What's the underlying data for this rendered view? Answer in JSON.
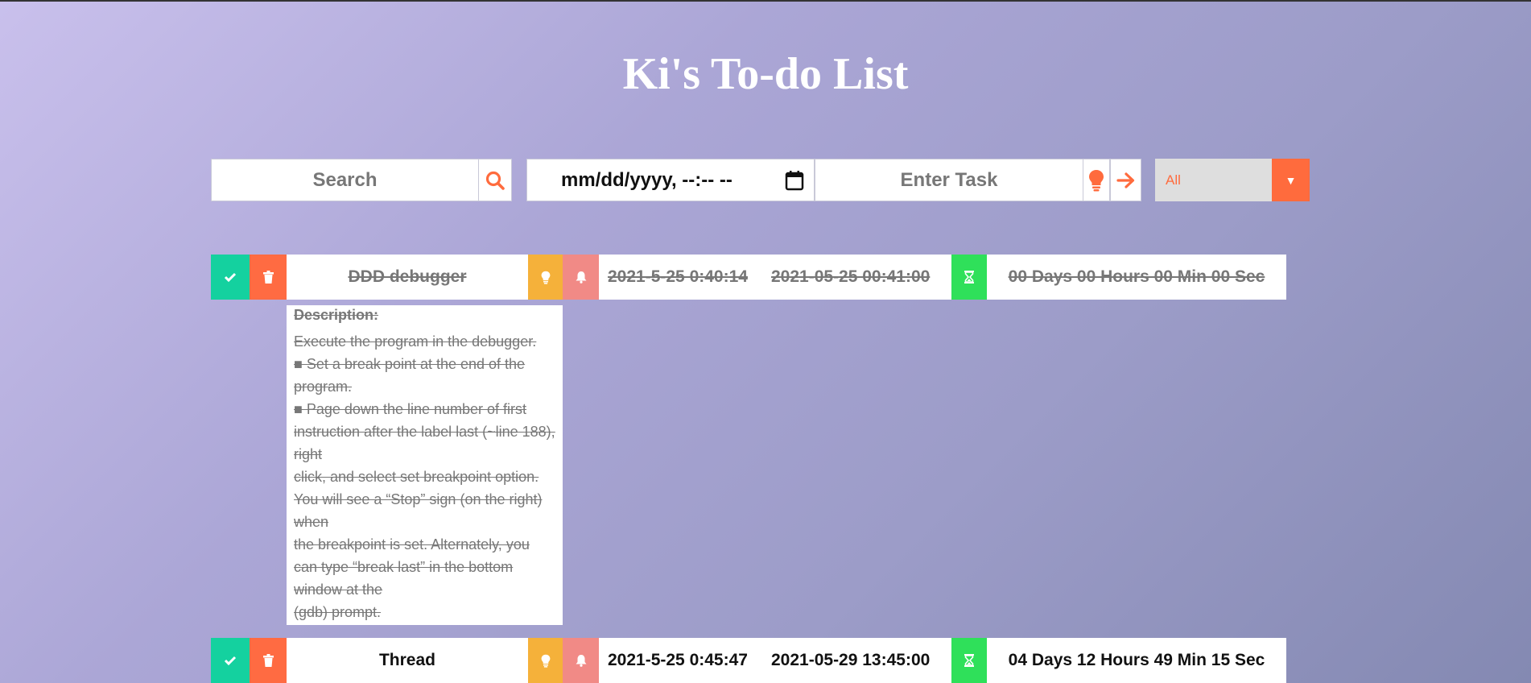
{
  "app": {
    "title": "Ki's To-do List"
  },
  "controls": {
    "search_placeholder": "Search",
    "datetime_placeholder": "mm/dd/yyyy, --:-- --",
    "task_placeholder": "Enter Task",
    "filter_selected": "All"
  },
  "colors": {
    "accent": "#ff6b3d",
    "complete": "#14d19f",
    "delete": "#ff6b42",
    "idea": "#f5b13a",
    "reminder": "#f18a86",
    "timer": "#2fe05a"
  },
  "icons": {
    "search": "search-icon",
    "calendar": "calendar-icon",
    "bulb": "lightbulb-icon",
    "arrow": "arrow-right-icon",
    "check": "check-icon",
    "trash": "trash-icon",
    "bell": "bell-icon",
    "hourglass": "hourglass-icon"
  },
  "tasks": [
    {
      "name": "DDD debugger",
      "start": "2021-5-25 0:40:14",
      "due": "2021-05-25 00:41:00",
      "remaining": "00 Days 00 Hours 00 Min 00 Sec",
      "completed": true,
      "description": {
        "title": "Description:",
        "lines": [
          "Execute the program in the debugger.",
          "■ Set a break point at the end of the program.",
          "■ Page down the line number of first instruction after the label last (~line 188), right",
          "click, and select set breakpoint option. You will see a “Stop” sign (on the right) when",
          "the breakpoint is set. Alternately, you can type “break last” in the bottom window at the",
          "(gdb) prompt."
        ]
      }
    },
    {
      "name": "Thread",
      "start": "2021-5-25 0:45:47",
      "due": "2021-05-29 13:45:00",
      "remaining": "04 Days 12 Hours 49 Min 15 Sec",
      "completed": false
    }
  ]
}
